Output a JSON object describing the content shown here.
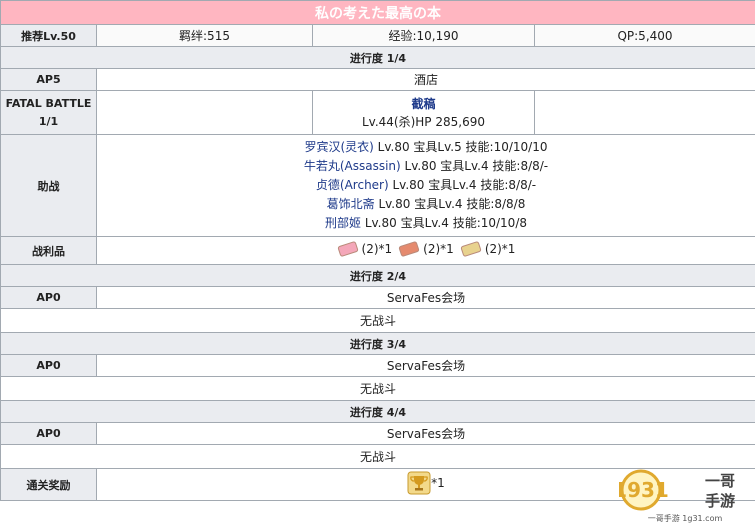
{
  "title": "私の考えた最高の本",
  "summary": {
    "level_label": "推荐Lv.50",
    "bond": "羁绊:515",
    "exp": "经验:10,190",
    "qp": "QP:5,400"
  },
  "stages": [
    {
      "header": "进行度 1/4",
      "ap": "AP5",
      "location": "酒店"
    },
    {
      "header": "进行度 2/4",
      "ap": "AP0",
      "location": "ServaFes会场",
      "battle": "无战斗"
    },
    {
      "header": "进行度 3/4",
      "ap": "AP0",
      "location": "ServaFes会场",
      "battle": "无战斗"
    },
    {
      "header": "进行度 4/4",
      "ap": "AP0",
      "location": "ServaFes会场",
      "battle": "无战斗"
    }
  ],
  "fatal_battle": {
    "label_line1": "FATAL BATTLE",
    "label_line2": "1/1",
    "enemy_name": "截稿",
    "enemy_stats": "Lv.44(杀)HP 285,690"
  },
  "support": {
    "label": "助战",
    "servants": [
      {
        "name": "罗宾汉(灵衣)",
        "detail": " Lv.80 宝具Lv.5 技能:10/10/10"
      },
      {
        "name": "牛若丸(Assassin)",
        "detail": " Lv.80 宝具Lv.4 技能:8/8/-"
      },
      {
        "name": "贞德(Archer)",
        "detail": " Lv.80 宝具Lv.4 技能:8/8/-"
      },
      {
        "name": "葛饰北斋",
        "detail": " Lv.80 宝具Lv.4 技能:8/8/8"
      },
      {
        "name": "刑部姬",
        "detail": " Lv.80 宝具Lv.4 技能:10/10/8"
      }
    ]
  },
  "loot": {
    "label": "战利品",
    "items": [
      {
        "icon": "pink-ticket-icon",
        "color": "#f4a7b9",
        "text": "(2)*1"
      },
      {
        "icon": "red-ticket-icon",
        "color": "#e58a6e",
        "text": "(2)*1"
      },
      {
        "icon": "gold-ticket-icon",
        "color": "#e8d28e",
        "text": "(2)*1"
      }
    ]
  },
  "clear_reward": {
    "label": "通关奖励",
    "icon": "trophy-icon",
    "text": "*1"
  },
  "watermark": {
    "brand": "1931",
    "line1": "一哥",
    "line2": "手游",
    "url": "一哥手游 1g31.com"
  }
}
